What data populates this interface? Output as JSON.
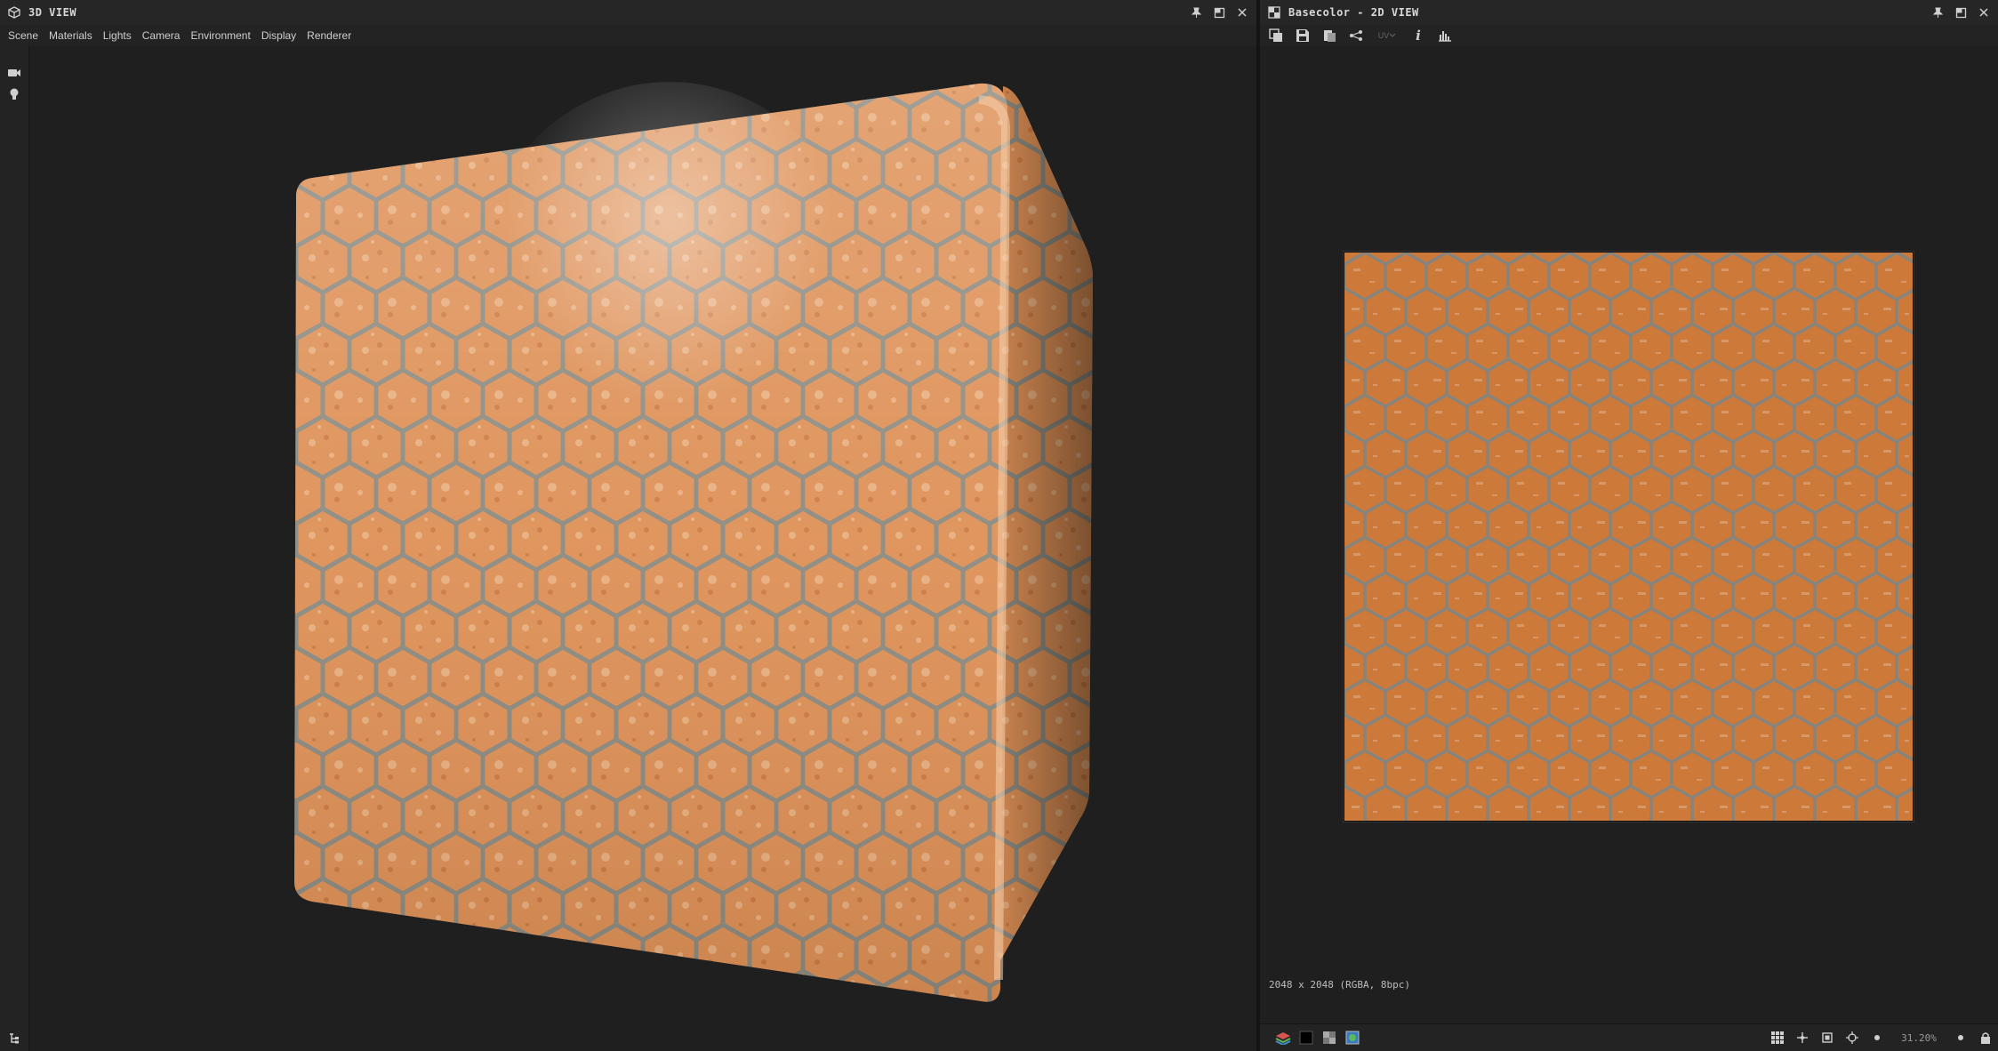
{
  "colors": {
    "accent": "#c8703a",
    "panel_bg": "#1f1f1f",
    "titlebar_bg": "#262626",
    "grout": "#8a8a82"
  },
  "view3d": {
    "title": "3D VIEW",
    "title_icon": "cube-icon",
    "menu": [
      "Scene",
      "Materials",
      "Lights",
      "Camera",
      "Environment",
      "Display",
      "Renderer"
    ],
    "side_tools": [
      "camera-icon",
      "light-bulb-icon"
    ]
  },
  "view2d": {
    "title": "Basecolor - 2D VIEW",
    "title_icon": "texture-icon",
    "toolbar": [
      "copy-icon",
      "save-icon",
      "paste-icon",
      "share-icon",
      "uv-icon",
      "info-icon",
      "histogram-icon"
    ],
    "uv_label": "UV",
    "image_info": "2048 x 2048 (RGBA, 8bpc)",
    "zoom": "31.20%"
  }
}
